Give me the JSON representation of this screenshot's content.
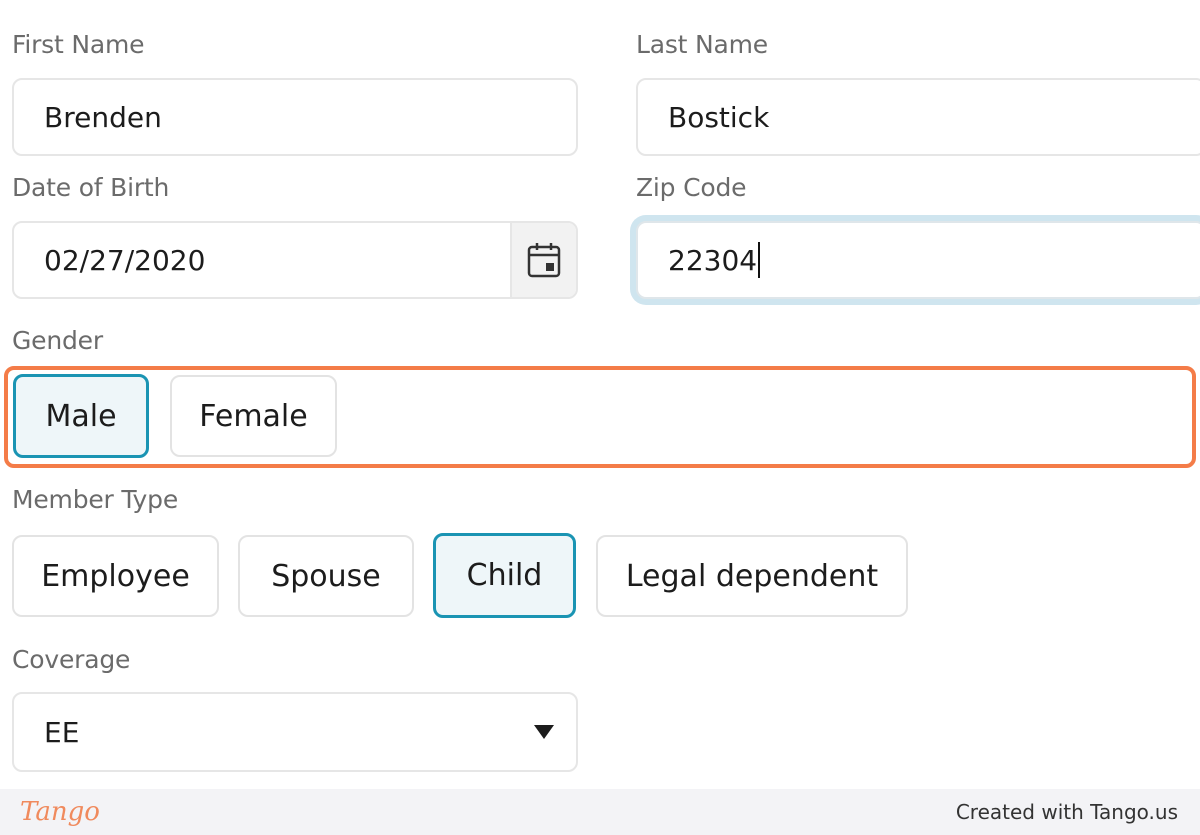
{
  "form": {
    "first_name": {
      "label": "First Name",
      "value": "Brenden"
    },
    "last_name": {
      "label": "Last Name",
      "value": "Bostick"
    },
    "date_of_birth": {
      "label": "Date of Birth",
      "value": "02/27/2020",
      "icon": "calendar-icon"
    },
    "zip_code": {
      "label": "Zip Code",
      "value": "22304"
    },
    "gender": {
      "label": "Gender",
      "options": [
        {
          "label": "Male",
          "selected": true
        },
        {
          "label": "Female",
          "selected": false
        }
      ]
    },
    "member_type": {
      "label": "Member Type",
      "options": [
        {
          "label": "Employee",
          "selected": false
        },
        {
          "label": "Spouse",
          "selected": false
        },
        {
          "label": "Child",
          "selected": true
        },
        {
          "label": "Legal dependent",
          "selected": false
        }
      ]
    },
    "coverage": {
      "label": "Coverage",
      "value": "EE"
    }
  },
  "footer": {
    "logo": "Tango",
    "text": "Created with Tango.us"
  },
  "colors": {
    "accent": "#1a94b3",
    "selected_bg": "#eef6f9",
    "highlight": "#f47c48",
    "focus_ring": "#cfe5ef"
  }
}
